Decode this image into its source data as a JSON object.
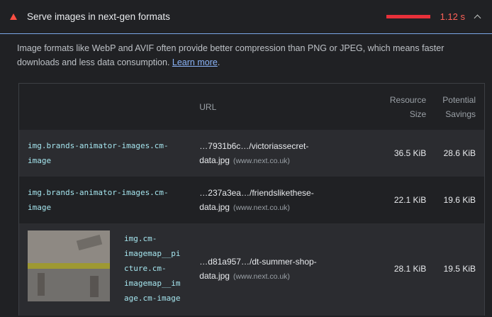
{
  "audit": {
    "title": "Serve images in next-gen formats",
    "savings": "1.12 s",
    "description": "Image formats like WebP and AVIF often provide better compression than PNG or JPEG, which means faster downloads and less data consumption. ",
    "learn_more": "Learn more",
    "description_end": "."
  },
  "table": {
    "headers": {
      "url": "URL",
      "size_line1": "Resource",
      "size_line2": "Size",
      "savings_line1": "Potential",
      "savings_line2": "Savings"
    },
    "rows": [
      {
        "node_line1": "img.brands-animator-images.cm-",
        "node_line2": "image",
        "url_line1": "…7931b6c…/victoriassecret-",
        "url_line2": "data.jpg",
        "host": "(www.next.co.uk)",
        "size": "36.5 KiB",
        "savings": "28.6 KiB"
      },
      {
        "node_line1": "img.brands-animator-images.cm-",
        "node_line2": "image",
        "url_line1": "…237a3ea…/friendslikethese-",
        "url_line2": "data.jpg",
        "host": "(www.next.co.uk)",
        "size": "22.1 KiB",
        "savings": "19.6 KiB"
      },
      {
        "node_lines": [
          "img.cm-",
          "imagemap__pi",
          "cture.cm-",
          "imagemap__im",
          "age.cm-image"
        ],
        "url_line1": "…d81a957…/dt-summer-shop-",
        "url_line2": "data.jpg",
        "host": "(www.next.co.uk)",
        "size": "28.1 KiB",
        "savings": "19.5 KiB"
      }
    ]
  },
  "icons": {
    "status": "fail-triangle-icon",
    "toggle": "chevron-up-icon"
  },
  "colors": {
    "fail": "#ff4e42",
    "link": "#8ab4f8",
    "node": "#a5e5ee",
    "accent_border": "#7aa7e8"
  }
}
